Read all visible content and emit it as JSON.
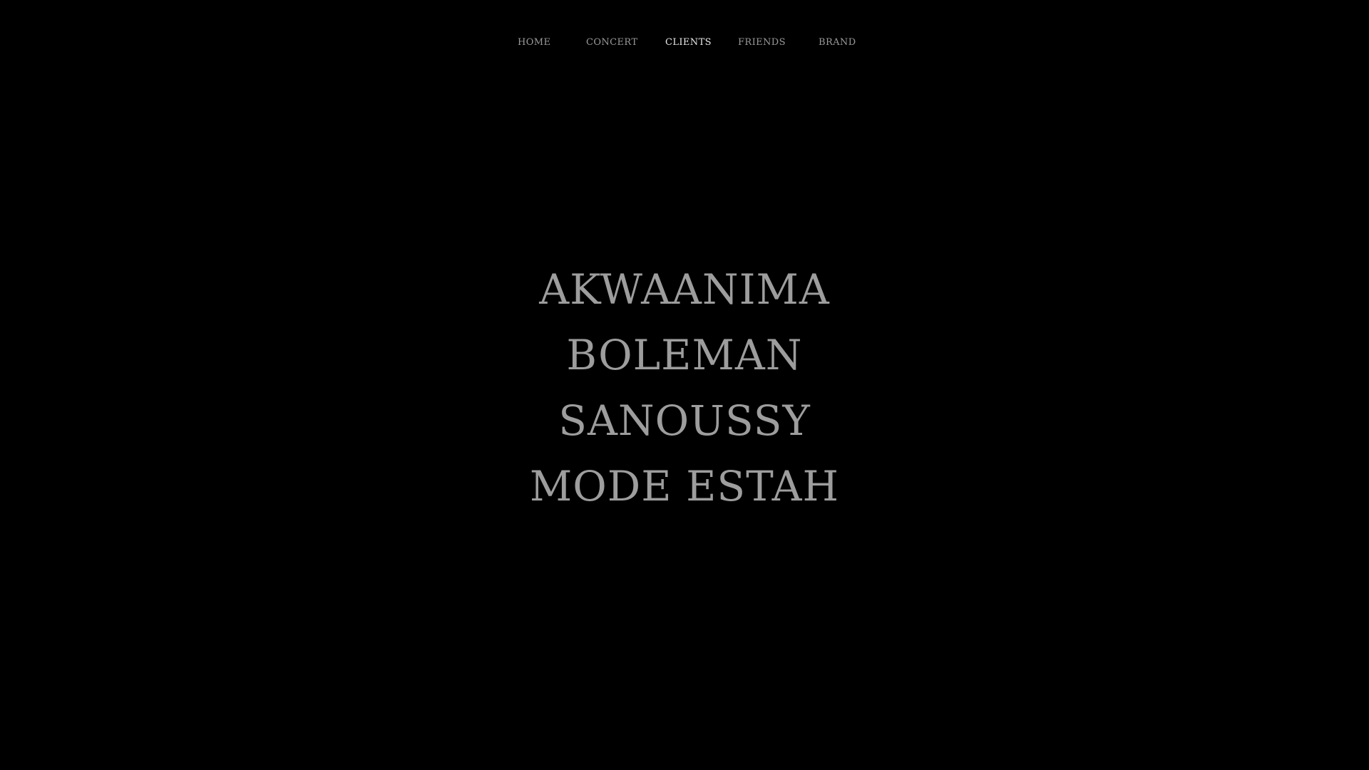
{
  "nav": {
    "items": [
      {
        "label": "HOME"
      },
      {
        "label": "CONCERT"
      },
      {
        "label": "CLIENTS"
      },
      {
        "label": "FRIENDS"
      },
      {
        "label": "BRAND"
      }
    ],
    "active": "CLIENTS"
  },
  "clients": [
    {
      "name": "AKWAANIMA"
    },
    {
      "name": "BOLEMAN"
    },
    {
      "name": "SANOUSSY"
    },
    {
      "name": "MODE ESTAH"
    }
  ],
  "colors": {
    "background": "#000000",
    "text": "#9d9d9d",
    "active_nav": "#e8e8e8"
  }
}
